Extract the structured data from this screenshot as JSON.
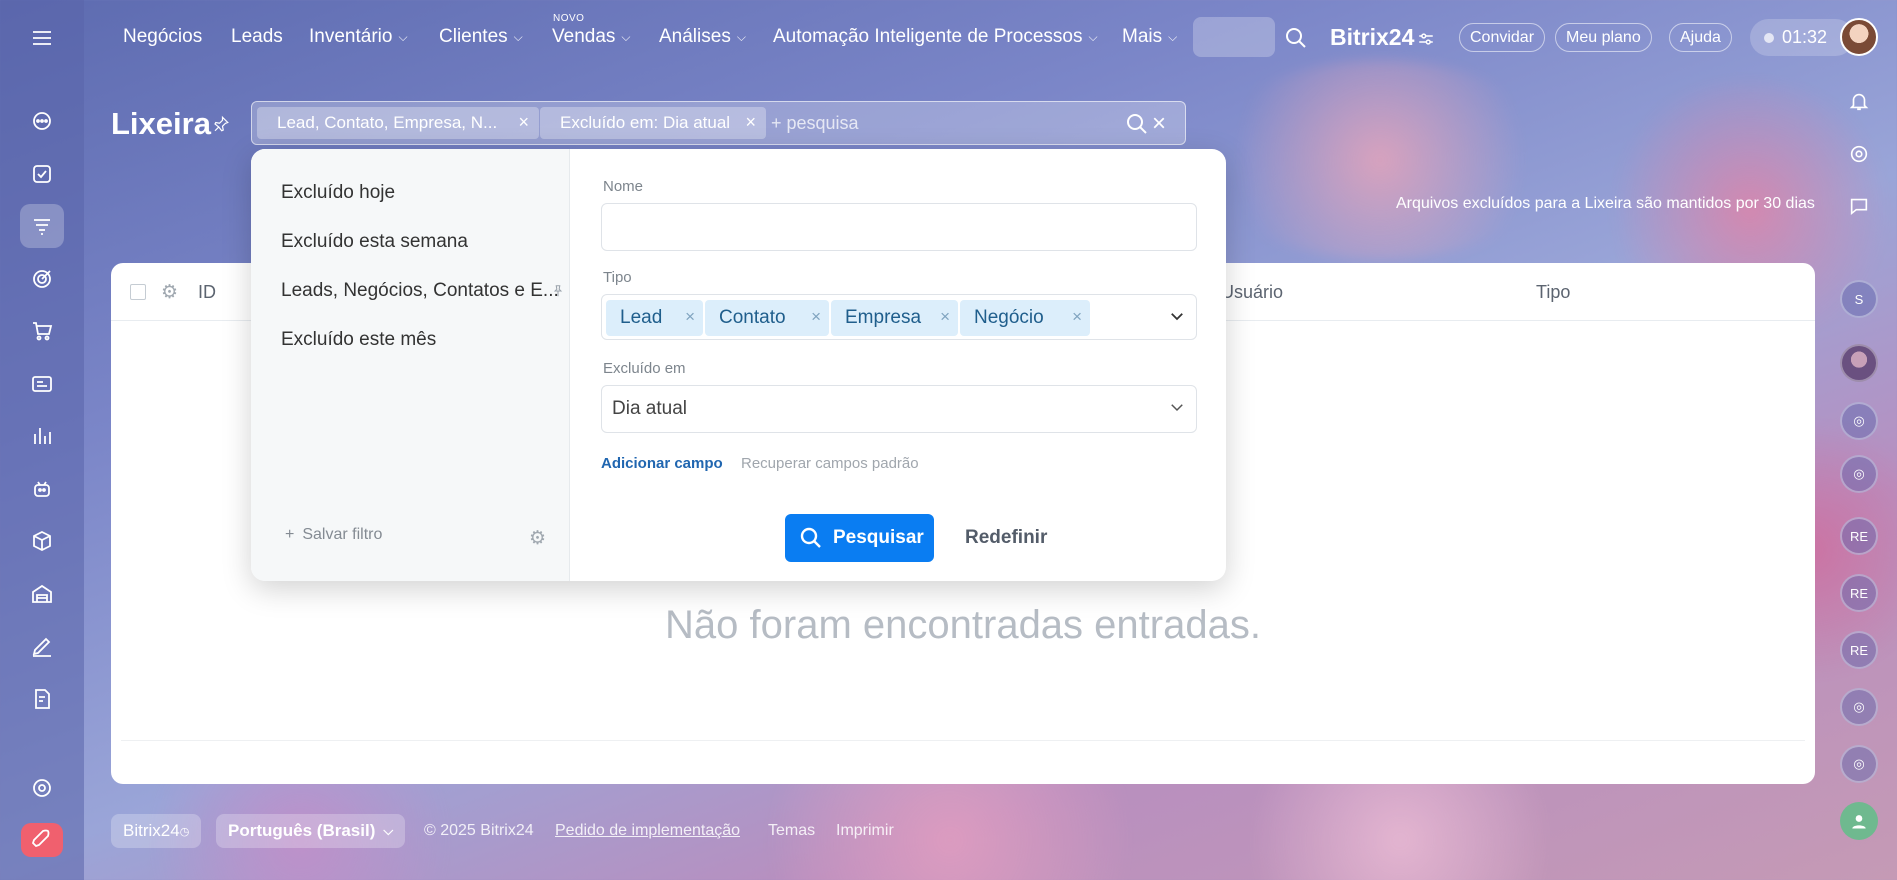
{
  "topnav": {
    "items": [
      {
        "label": "Negócios",
        "chevron": false
      },
      {
        "label": "Leads",
        "chevron": false
      },
      {
        "label": "Inventário",
        "chevron": true
      },
      {
        "label": "Clientes",
        "chevron": true
      },
      {
        "label": "Vendas",
        "chevron": true,
        "badge": "NOVO"
      },
      {
        "label": "Análises",
        "chevron": true
      },
      {
        "label": "Automação Inteligente de Processos",
        "chevron": true
      },
      {
        "label": "Mais",
        "chevron": true
      }
    ],
    "brand": "Bitrix24",
    "invite_label": "Convidar",
    "plan_label": "Meu plano",
    "help_label": "Ajuda",
    "clock": "01:32"
  },
  "page": {
    "title": "Lixeira",
    "retention_notice": "Arquivos excluídos para a Lixeira são mantidos por 30 dias"
  },
  "filter": {
    "chips": [
      "Lead, Contato, Empresa, N...",
      "Excluído em: Dia atual"
    ],
    "placeholder": "+ pesquisa"
  },
  "filter_popup": {
    "presets": [
      "Excluído hoje",
      "Excluído esta semana",
      "Leads, Negócios, Contatos e E...",
      "Excluído este mês"
    ],
    "save_filter_label": "Salvar filtro",
    "fields": {
      "name_label": "Nome",
      "name_value": "",
      "type_label": "Tipo",
      "type_tags": [
        "Lead",
        "Contato",
        "Empresa",
        "Negócio"
      ],
      "deleted_label": "Excluído em",
      "deleted_value": "Dia atual"
    },
    "add_field_label": "Adicionar campo",
    "restore_fields_label": "Recuperar campos padrão",
    "search_button": "Pesquisar",
    "reset_button": "Redefinir"
  },
  "grid": {
    "columns": [
      "ID",
      "Usuário",
      "Tipo"
    ],
    "empty_message": "Não foram encontradas entradas."
  },
  "right_sidebar": {
    "avatar_initials": [
      "S",
      "RE",
      "RE",
      "RE"
    ]
  },
  "footer": {
    "brand": "Bitrix24",
    "language": "Português (Brasil)",
    "copyright": "© 2025 Bitrix24",
    "links": [
      "Pedido de implementação",
      "Temas",
      "Imprimir"
    ]
  },
  "colors": {
    "accent": "#0a7df2",
    "tag_bg": "#dceefb"
  }
}
